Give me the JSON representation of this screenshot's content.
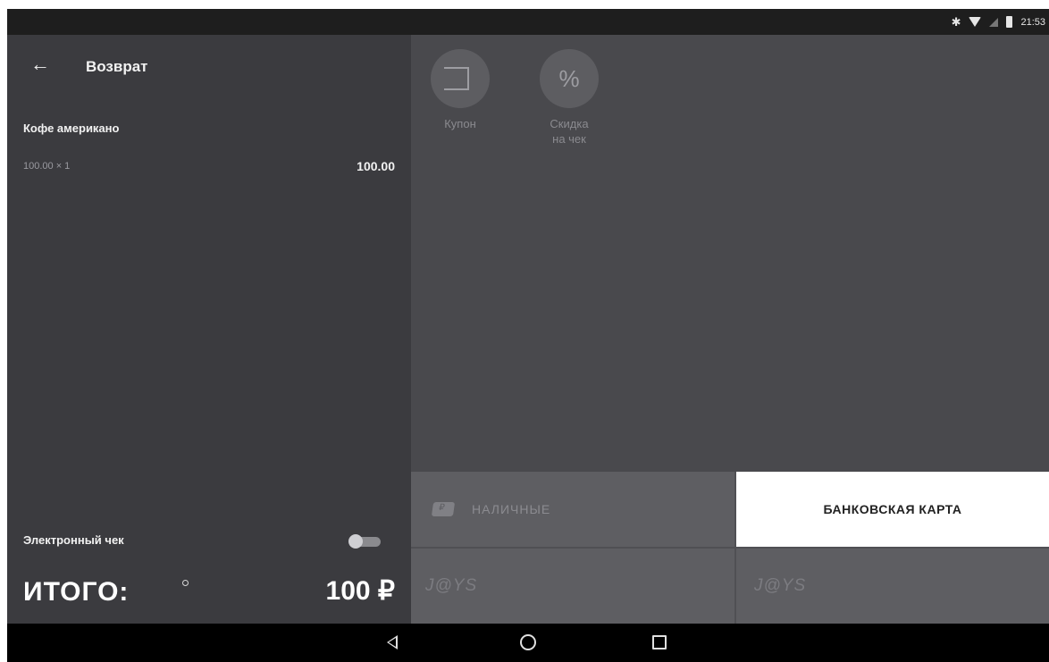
{
  "status_bar": {
    "time": "21:53"
  },
  "header": {
    "title": "Возврат"
  },
  "receipt": {
    "items": [
      {
        "name": "Кофе американо",
        "qty_price": "100.00 × 1",
        "total": "100.00"
      }
    ],
    "e_receipt_label": "Электронный чек",
    "e_receipt_enabled": false,
    "total_label": "ИТОГО:",
    "total_value": "100 ₽"
  },
  "actions": [
    {
      "label": "Купон",
      "icon": "coupon-icon"
    },
    {
      "label": "Скидка\nна чек",
      "icon": "percent-icon",
      "symbol": "%"
    }
  ],
  "payments": {
    "cash_label": "НАЛИЧНЫЕ",
    "card_label": "БАНКОВСКАЯ КАРТА",
    "joys_1": "J@YS",
    "joys_2": "J@YS"
  },
  "colors": {
    "left_panel_bg": "#3b3b3f",
    "right_panel_bg": "#49494d",
    "selected_payment_bg": "#ffffff"
  }
}
